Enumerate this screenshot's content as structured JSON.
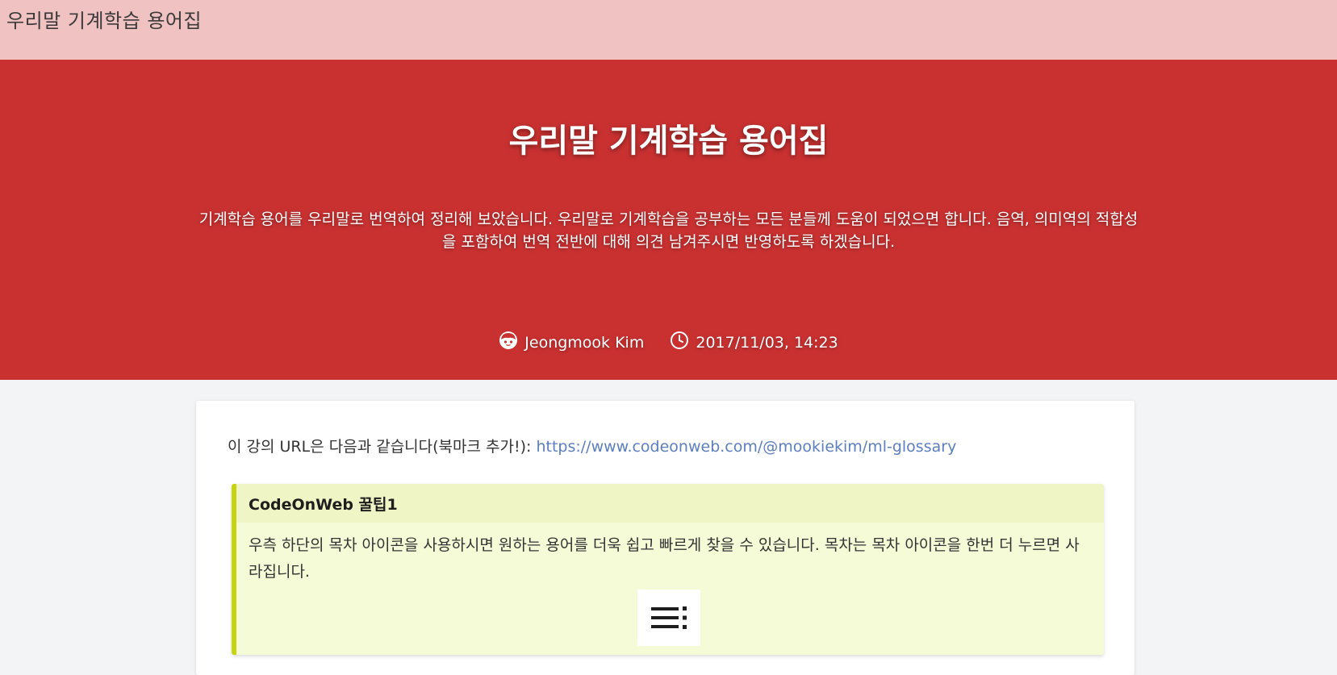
{
  "topbar": {
    "site_title": "우리말 기계학습 용어집"
  },
  "hero": {
    "title": "우리말 기계학습 용어집",
    "description": "기계학습 용어를 우리말로 번역하여 정리해 보았습니다. 우리말로 기계학습을 공부하는 모든 분들께 도움이 되었으면 합니다. 음역, 의미역의 적합성을 포함하여 번역 전반에 대해 의견 남겨주시면 반영하도록 하겠습니다.",
    "author": "Jeongmook Kim",
    "datetime": "2017/11/03, 14:23",
    "background_color": "#c93131"
  },
  "content": {
    "url_prefix": "이 강의 URL은 다음과 같습니다(북마크 추가!): ",
    "url": "https://www.codeonweb.com/@mookiekim/ml-glossary",
    "tip": {
      "title": "CodeOnWeb 꿀팁1",
      "body": "우측 하단의 목차 아이콘을 사용하시면 원하는 용어를 더욱 쉽고 빠르게 찾을 수 있습니다. 목차는 목차 아이콘을 한번 더 누르면 사라집니다.",
      "icon": "toc-icon",
      "accent_color": "#c6d40f"
    }
  }
}
